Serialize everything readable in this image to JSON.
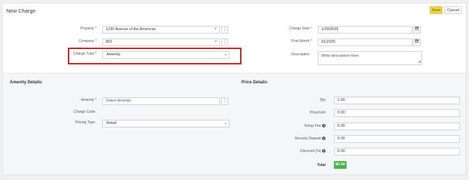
{
  "header": {
    "title": "New Charge",
    "save_label": "Save",
    "cancel_label": "Cancel"
  },
  "form": {
    "property": {
      "label": "Property",
      "required": "*",
      "value": "1230 Avenue of the Americas",
      "clear": "×",
      "menu": "⋮"
    },
    "company": {
      "label": "Company",
      "required": "*",
      "value": "802",
      "clear": "×",
      "menu": "⋮"
    },
    "charge_type": {
      "label": "Charge Type",
      "required": "*",
      "value": "Amenity"
    },
    "charge_date": {
      "label": "Charge Date",
      "required": "*",
      "value": "1/29/2025"
    },
    "post_month": {
      "label": "Post Month",
      "required": "*",
      "value": "01/2025"
    },
    "description": {
      "label": "Description",
      "placeholder": "Write description here"
    }
  },
  "amenity_details": {
    "heading": "Amenity Details:",
    "amenity": {
      "label": "Amenity",
      "required": "*",
      "placeholder": "Select Amenity",
      "menu": "⋮"
    },
    "charge_code": {
      "label": "Charge Code"
    },
    "pricing_type": {
      "label": "Pricing Type",
      "value": "Retail"
    }
  },
  "price_details": {
    "heading": "Price Details:",
    "qty": {
      "label": "Qty",
      "value": "1.00"
    },
    "price_unit": {
      "label": "Price/Unit",
      "value": "0.00"
    },
    "setup_fee": {
      "label": "Setup Fee",
      "value": "0.00",
      "help": "?"
    },
    "security_deposit": {
      "label": "Security Deposit",
      "value": "0.00",
      "help": "?"
    },
    "discount": {
      "label": "Discount (%)",
      "value": "0.00",
      "help": "?"
    },
    "total": {
      "label": "Total",
      "value": "$0.00"
    }
  },
  "icons": {
    "calendar": "calendar-icon",
    "kebab": "kebab-menu-icon",
    "chevron": "chevron-down-icon"
  },
  "colors": {
    "save": "#f0d24a",
    "highlight": "#d71b22",
    "total_badge": "#45b649"
  }
}
